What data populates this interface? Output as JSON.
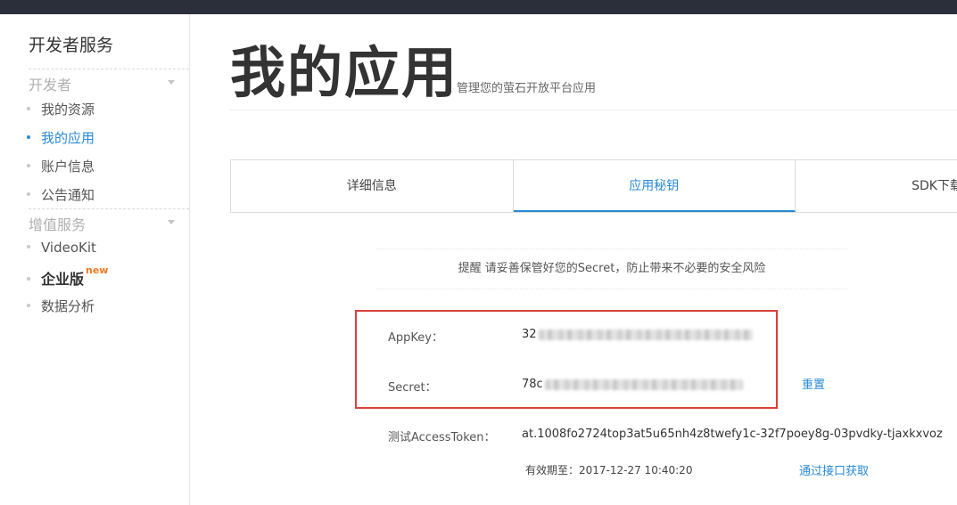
{
  "sidebar": {
    "title": "开发者服务",
    "groups": [
      {
        "label": "开发者",
        "items": [
          {
            "label": "我的资源"
          },
          {
            "label": "我的应用"
          },
          {
            "label": "账户信息"
          },
          {
            "label": "公告通知"
          }
        ]
      },
      {
        "label": "增值服务",
        "items": [
          {
            "label": "VideoKit"
          },
          {
            "label": "企业版",
            "badge": "new"
          },
          {
            "label": "数据分析"
          }
        ]
      }
    ],
    "active_item": "我的应用"
  },
  "header": {
    "title": "我的应用",
    "subtitle": "管理您的萤石开放平台应用"
  },
  "tabs": [
    {
      "label": "详细信息"
    },
    {
      "label": "应用秘钥"
    },
    {
      "label": "SDK下载"
    }
  ],
  "active_tab": "应用秘钥",
  "notice": "提醒 请妥善保管好您的Secret，防止带来不必要的安全风险",
  "credentials": {
    "appkey_label": "AppKey：",
    "appkey_prefix": "32",
    "secret_label": "Secret：",
    "secret_prefix": "78c",
    "reset_label": "重置",
    "token_label": "测试AccessToken：",
    "token_value": "at.1008fo2724top3at5u65nh4z8twefy1c-32f7poey8g-03pvdky-tjaxkxvoz",
    "expiry_text": "有效期至：2017-12-27 10:40:20",
    "fetch_link": "通过接口获取"
  },
  "colors": {
    "accent": "#2a8ad4",
    "highlight_box": "#d9413a",
    "new_badge": "#f07c22",
    "topbar": "#2b2f3a"
  },
  "icons": {
    "group_toggle": "caret-down-icon",
    "bullet": "dot-icon"
  }
}
